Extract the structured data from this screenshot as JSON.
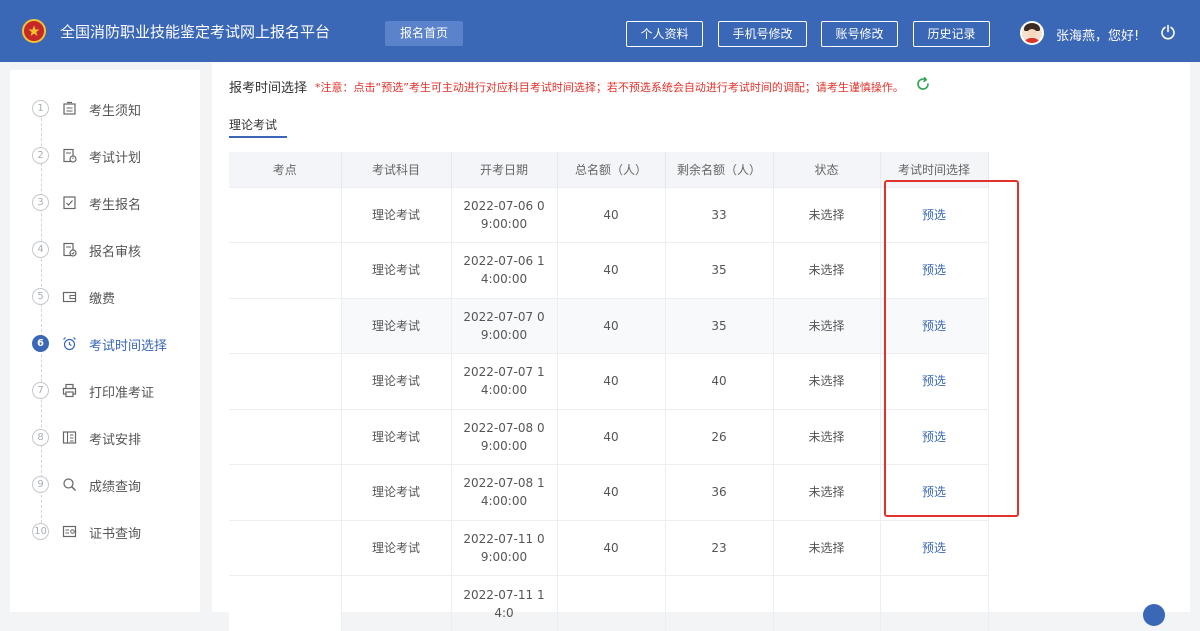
{
  "header": {
    "title": "全国消防职业技能鉴定考试网上报名平台",
    "nav_home": "报名首页",
    "buttons": [
      "个人资料",
      "手机号修改",
      "账号修改",
      "历史记录"
    ],
    "greeting": "张海燕，您好!"
  },
  "sidebar": {
    "steps": [
      {
        "num": "1",
        "label": "考生须知",
        "icon": "notice-icon"
      },
      {
        "num": "2",
        "label": "考试计划",
        "icon": "plan-icon"
      },
      {
        "num": "3",
        "label": "考生报名",
        "icon": "signup-icon"
      },
      {
        "num": "4",
        "label": "报名审核",
        "icon": "review-icon"
      },
      {
        "num": "5",
        "label": "缴费",
        "icon": "wallet-icon"
      },
      {
        "num": "6",
        "label": "考试时间选择",
        "icon": "alarm-clock-icon",
        "active": true
      },
      {
        "num": "7",
        "label": "打印准考证",
        "icon": "printer-icon"
      },
      {
        "num": "8",
        "label": "考试安排",
        "icon": "schedule-icon"
      },
      {
        "num": "9",
        "label": "成绩查询",
        "icon": "search-icon"
      },
      {
        "num": "10",
        "label": "证书查询",
        "icon": "certificate-icon"
      }
    ]
  },
  "main": {
    "section_title": "报考时间选择",
    "notice": "*注意：点击“预选”考生可主动进行对应科目考试时间选择；若不预选系统会自动进行考试时间的调配；请考生谨慎操作。",
    "tab": "理论考试",
    "table": {
      "headers": [
        "考点",
        "考试科目",
        "开考日期",
        "总名额（人）",
        "剩余名额（人）",
        "状态",
        "考试时间选择"
      ],
      "rows": [
        {
          "site": "",
          "subject": "理论考试",
          "date": "2022-07-06 09:00:00",
          "total": "40",
          "remaining": "33",
          "status": "未选择",
          "action": "预选"
        },
        {
          "site": "",
          "subject": "理论考试",
          "date": "2022-07-06 14:00:00",
          "total": "40",
          "remaining": "35",
          "status": "未选择",
          "action": "预选"
        },
        {
          "site": "",
          "subject": "理论考试",
          "date": "2022-07-07 09:00:00",
          "total": "40",
          "remaining": "35",
          "status": "未选择",
          "action": "预选"
        },
        {
          "site": "",
          "subject": "理论考试",
          "date": "2022-07-07 14:00:00",
          "total": "40",
          "remaining": "40",
          "status": "未选择",
          "action": "预选"
        },
        {
          "site": "",
          "subject": "理论考试",
          "date": "2022-07-08 09:00:00",
          "total": "40",
          "remaining": "26",
          "status": "未选择",
          "action": "预选"
        },
        {
          "site": "",
          "subject": "理论考试",
          "date": "2022-07-08 14:00:00",
          "total": "40",
          "remaining": "36",
          "status": "未选择",
          "action": "预选"
        },
        {
          "site": "",
          "subject": "理论考试",
          "date": "2022-07-11 09:00:00",
          "total": "40",
          "remaining": "23",
          "status": "未选择",
          "action": "预选"
        },
        {
          "site": "",
          "subject": "",
          "date": "2022-07-11 14:0",
          "total": "",
          "remaining": "",
          "status": "",
          "action": ""
        }
      ]
    }
  },
  "colors": {
    "primary": "#3a67b6",
    "danger": "#e0322b",
    "header_bg": "#3a67b6"
  }
}
